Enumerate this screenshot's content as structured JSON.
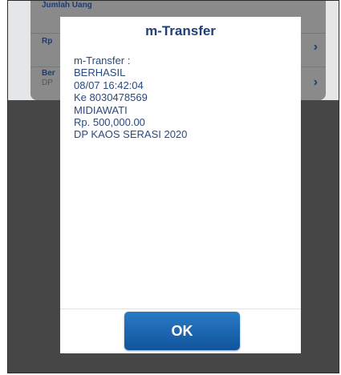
{
  "background": {
    "partial_header": "Jumlah Uang",
    "row1_label": "Rp",
    "row2_label": "Ber",
    "row2_sub": "DP"
  },
  "dialog": {
    "title": "m-Transfer",
    "lines": [
      "m-Transfer :",
      "BERHASIL",
      "08/07 16:42:04",
      "Ke 8030478569",
      "MIDIAWATI",
      "Rp. 500,000.00",
      "DP KAOS SERASI 2020"
    ],
    "ok_label": "OK"
  },
  "colors": {
    "accent": "#1f3f7a",
    "button": "#1a66b5",
    "overlay": "#464646"
  },
  "icons": [
    "chevron-right-icon",
    "chevron-right-icon"
  ]
}
